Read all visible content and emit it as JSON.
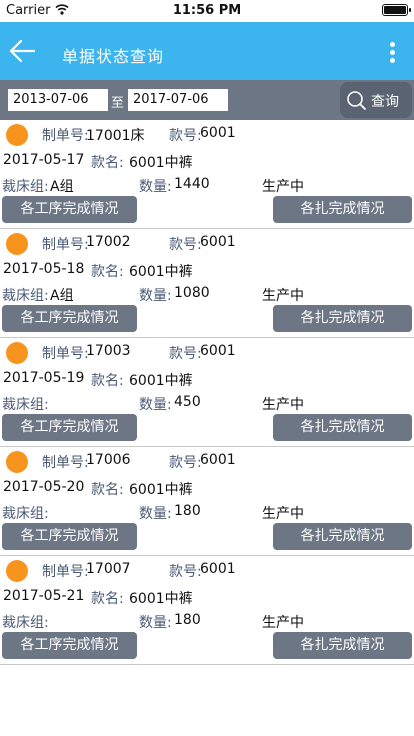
{
  "status": {
    "carrier": "Carrier",
    "time": "11:56 PM"
  },
  "nav": {
    "title": "单据状态查询"
  },
  "search": {
    "from_date": "2013-07-06",
    "to_label": "至",
    "to_date": "2017-07-06",
    "button_label": "查询"
  },
  "labels": {
    "order_no": "制单号:",
    "style_no": "款号:",
    "style_name": "款名:",
    "cutting_group": "裁床组:",
    "quantity": "数量:",
    "process_button": "各工序完成情况",
    "bundle_button": "各扎完成情况"
  },
  "records": [
    {
      "order_no": "17001床",
      "style_no": "6001",
      "date": "2017-05-17",
      "style_name": "6001中裤",
      "group": "A组",
      "quantity": "1440",
      "status": "生产中",
      "status_color": "#f7941d"
    },
    {
      "order_no": "17002",
      "style_no": "6001",
      "date": "2017-05-18",
      "style_name": "6001中裤",
      "group": "A组",
      "quantity": "1080",
      "status": "生产中",
      "status_color": "#f7941d"
    },
    {
      "order_no": "17003",
      "style_no": "6001",
      "date": "2017-05-19",
      "style_name": "6001中裤",
      "group": "",
      "quantity": "450",
      "status": "生产中",
      "status_color": "#f7941d"
    },
    {
      "order_no": "17006",
      "style_no": "6001",
      "date": "2017-05-20",
      "style_name": "6001中裤",
      "group": "",
      "quantity": "180",
      "status": "生产中",
      "status_color": "#f7941d"
    },
    {
      "order_no": "17007",
      "style_no": "6001",
      "date": "2017-05-21",
      "style_name": "6001中裤",
      "group": "",
      "quantity": "180",
      "status": "生产中",
      "status_color": "#f7941d"
    }
  ],
  "colors": {
    "nav": "#3cb4ee",
    "toolbar": "#6c7685",
    "button": "#6c7685",
    "label": "#4a5a75"
  }
}
